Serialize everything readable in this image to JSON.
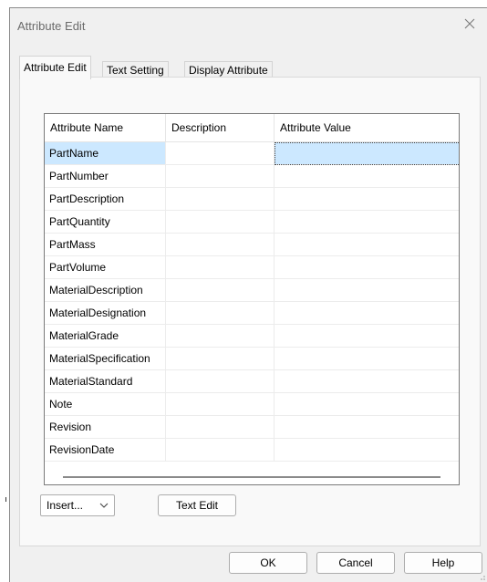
{
  "window": {
    "title": "Attribute Edit"
  },
  "tabs": [
    {
      "label": "Attribute Edit",
      "active": true
    },
    {
      "label": "Text Setting",
      "active": false
    },
    {
      "label": "Display Attribute",
      "active": false
    }
  ],
  "grid": {
    "columns": [
      "Attribute Name",
      "Description",
      "Attribute Value"
    ],
    "rows": [
      {
        "name": "PartName",
        "description": "",
        "value": "",
        "selected": true
      },
      {
        "name": "PartNumber",
        "description": "",
        "value": ""
      },
      {
        "name": "PartDescription",
        "description": "",
        "value": ""
      },
      {
        "name": "PartQuantity",
        "description": "",
        "value": ""
      },
      {
        "name": "PartMass",
        "description": "",
        "value": ""
      },
      {
        "name": "PartVolume",
        "description": "",
        "value": ""
      },
      {
        "name": "MaterialDescription",
        "description": "",
        "value": ""
      },
      {
        "name": "MaterialDesignation",
        "description": "",
        "value": ""
      },
      {
        "name": "MaterialGrade",
        "description": "",
        "value": ""
      },
      {
        "name": "MaterialSpecification",
        "description": "",
        "value": ""
      },
      {
        "name": "MaterialStandard",
        "description": "",
        "value": ""
      },
      {
        "name": "Note",
        "description": "",
        "value": ""
      },
      {
        "name": "Revision",
        "description": "",
        "value": ""
      },
      {
        "name": "RevisionDate",
        "description": "",
        "value": ""
      }
    ]
  },
  "controls": {
    "insert_label": "Insert...",
    "text_edit_label": "Text Edit"
  },
  "footer": {
    "ok_label": "OK",
    "cancel_label": "Cancel",
    "help_label": "Help"
  },
  "colors": {
    "selection": "#cce8ff",
    "dialog_bg": "#f0f0f0"
  }
}
